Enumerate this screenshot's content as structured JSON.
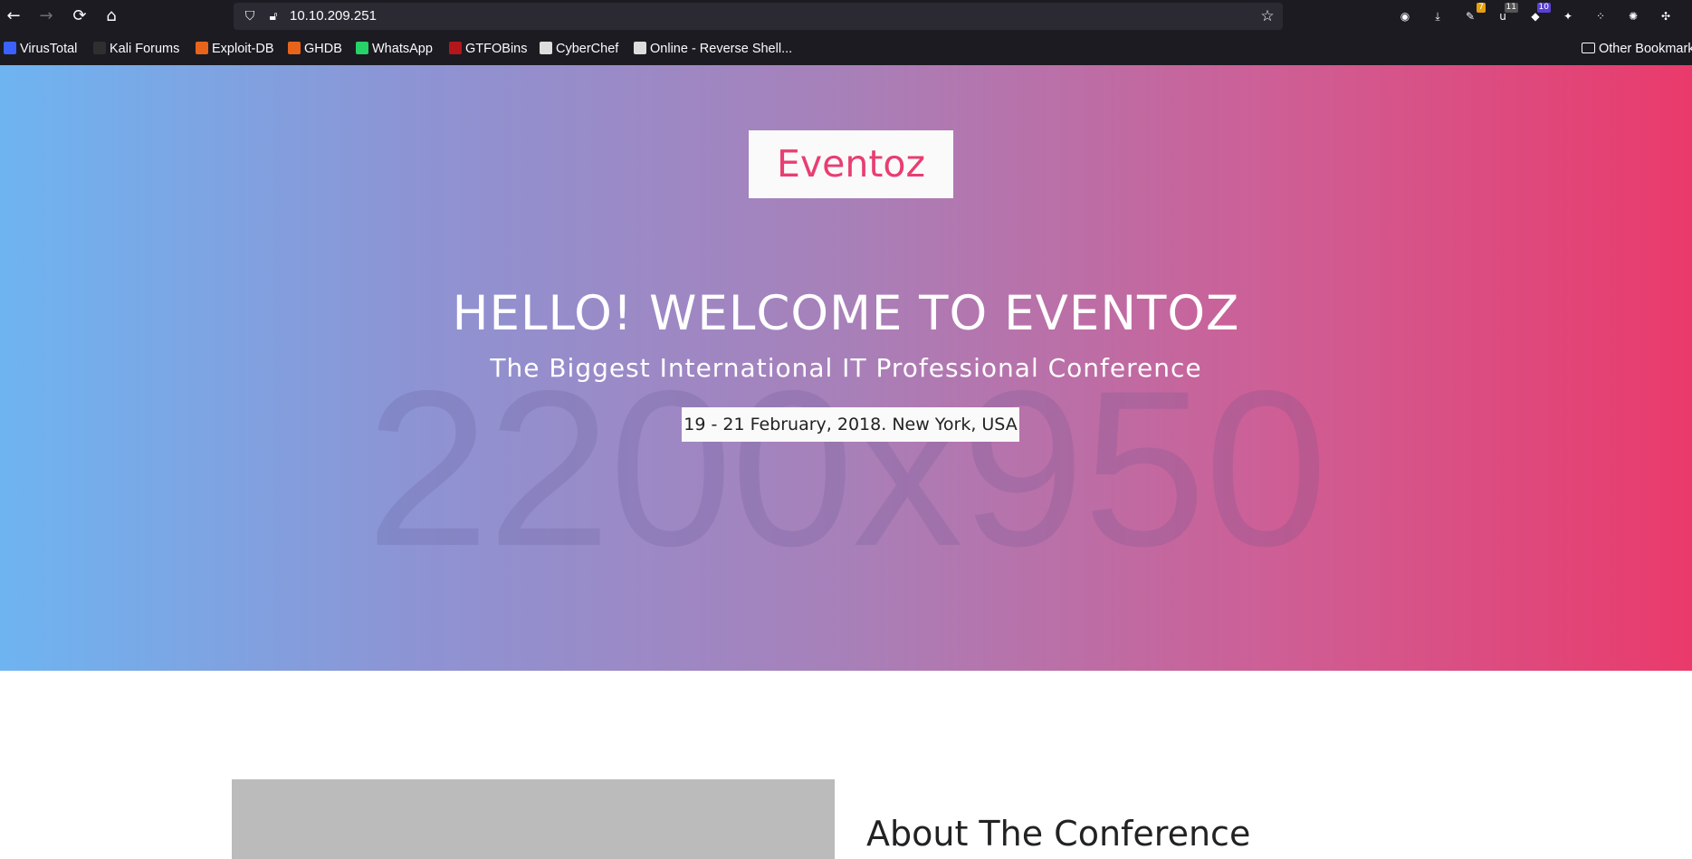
{
  "browser": {
    "url": "10.10.209.251",
    "nav": {
      "back": "←",
      "forward": "→",
      "reload": "⟳",
      "home": "⌂"
    },
    "extensions": [
      {
        "name": "pocket-icon",
        "glyph": "◉",
        "badge": ""
      },
      {
        "name": "downloads-icon",
        "glyph": "⤓",
        "badge": ""
      },
      {
        "name": "extension-7-icon",
        "glyph": "✎",
        "badge": "7",
        "badge_color": "#e5a00d"
      },
      {
        "name": "ublock-icon",
        "glyph": "u",
        "badge": "11",
        "badge_color": "#555555"
      },
      {
        "name": "wappalyzer-icon",
        "glyph": "◆",
        "badge": "10",
        "badge_color": "#5b3fd6"
      },
      {
        "name": "foxyproxy-icon",
        "glyph": "✦",
        "badge": ""
      },
      {
        "name": "extension-dots-icon",
        "glyph": "⁘",
        "badge": ""
      },
      {
        "name": "cookie-icon",
        "glyph": "✺",
        "badge": ""
      },
      {
        "name": "extensions-puzzle-icon",
        "glyph": "✣",
        "badge": ""
      }
    ],
    "bookmarks": [
      {
        "label": "VirusTotal",
        "icon": "virustotal-icon",
        "color": "#3b61ff"
      },
      {
        "label": "Kali Forums",
        "icon": "kali-icon",
        "color": "#2f2f2f"
      },
      {
        "label": "Exploit-DB",
        "icon": "exploitdb-icon",
        "color": "#e8641b"
      },
      {
        "label": "GHDB",
        "icon": "ghdb-icon",
        "color": "#e8641b"
      },
      {
        "label": "WhatsApp",
        "icon": "whatsapp-icon",
        "color": "#25d366"
      },
      {
        "label": "GTFOBins",
        "icon": "gtfobins-icon",
        "color": "#b3161b"
      },
      {
        "label": "CyberChef",
        "icon": "cyberchef-icon",
        "color": "#dddddd"
      },
      {
        "label": "Online - Reverse Shell...",
        "icon": "skull-icon",
        "color": "#dddddd"
      }
    ],
    "other_bookmarks": "Other Bookmarks"
  },
  "hero": {
    "logo": "Eventoz",
    "title": "HELLO! WELCOME TO EVENTOZ",
    "subtitle": "The Biggest International IT Professional Conference",
    "date": "19 - 21 February, 2018. New York, USA",
    "placeholder_text": "2200x950"
  },
  "about": {
    "heading": "About The Conference"
  }
}
